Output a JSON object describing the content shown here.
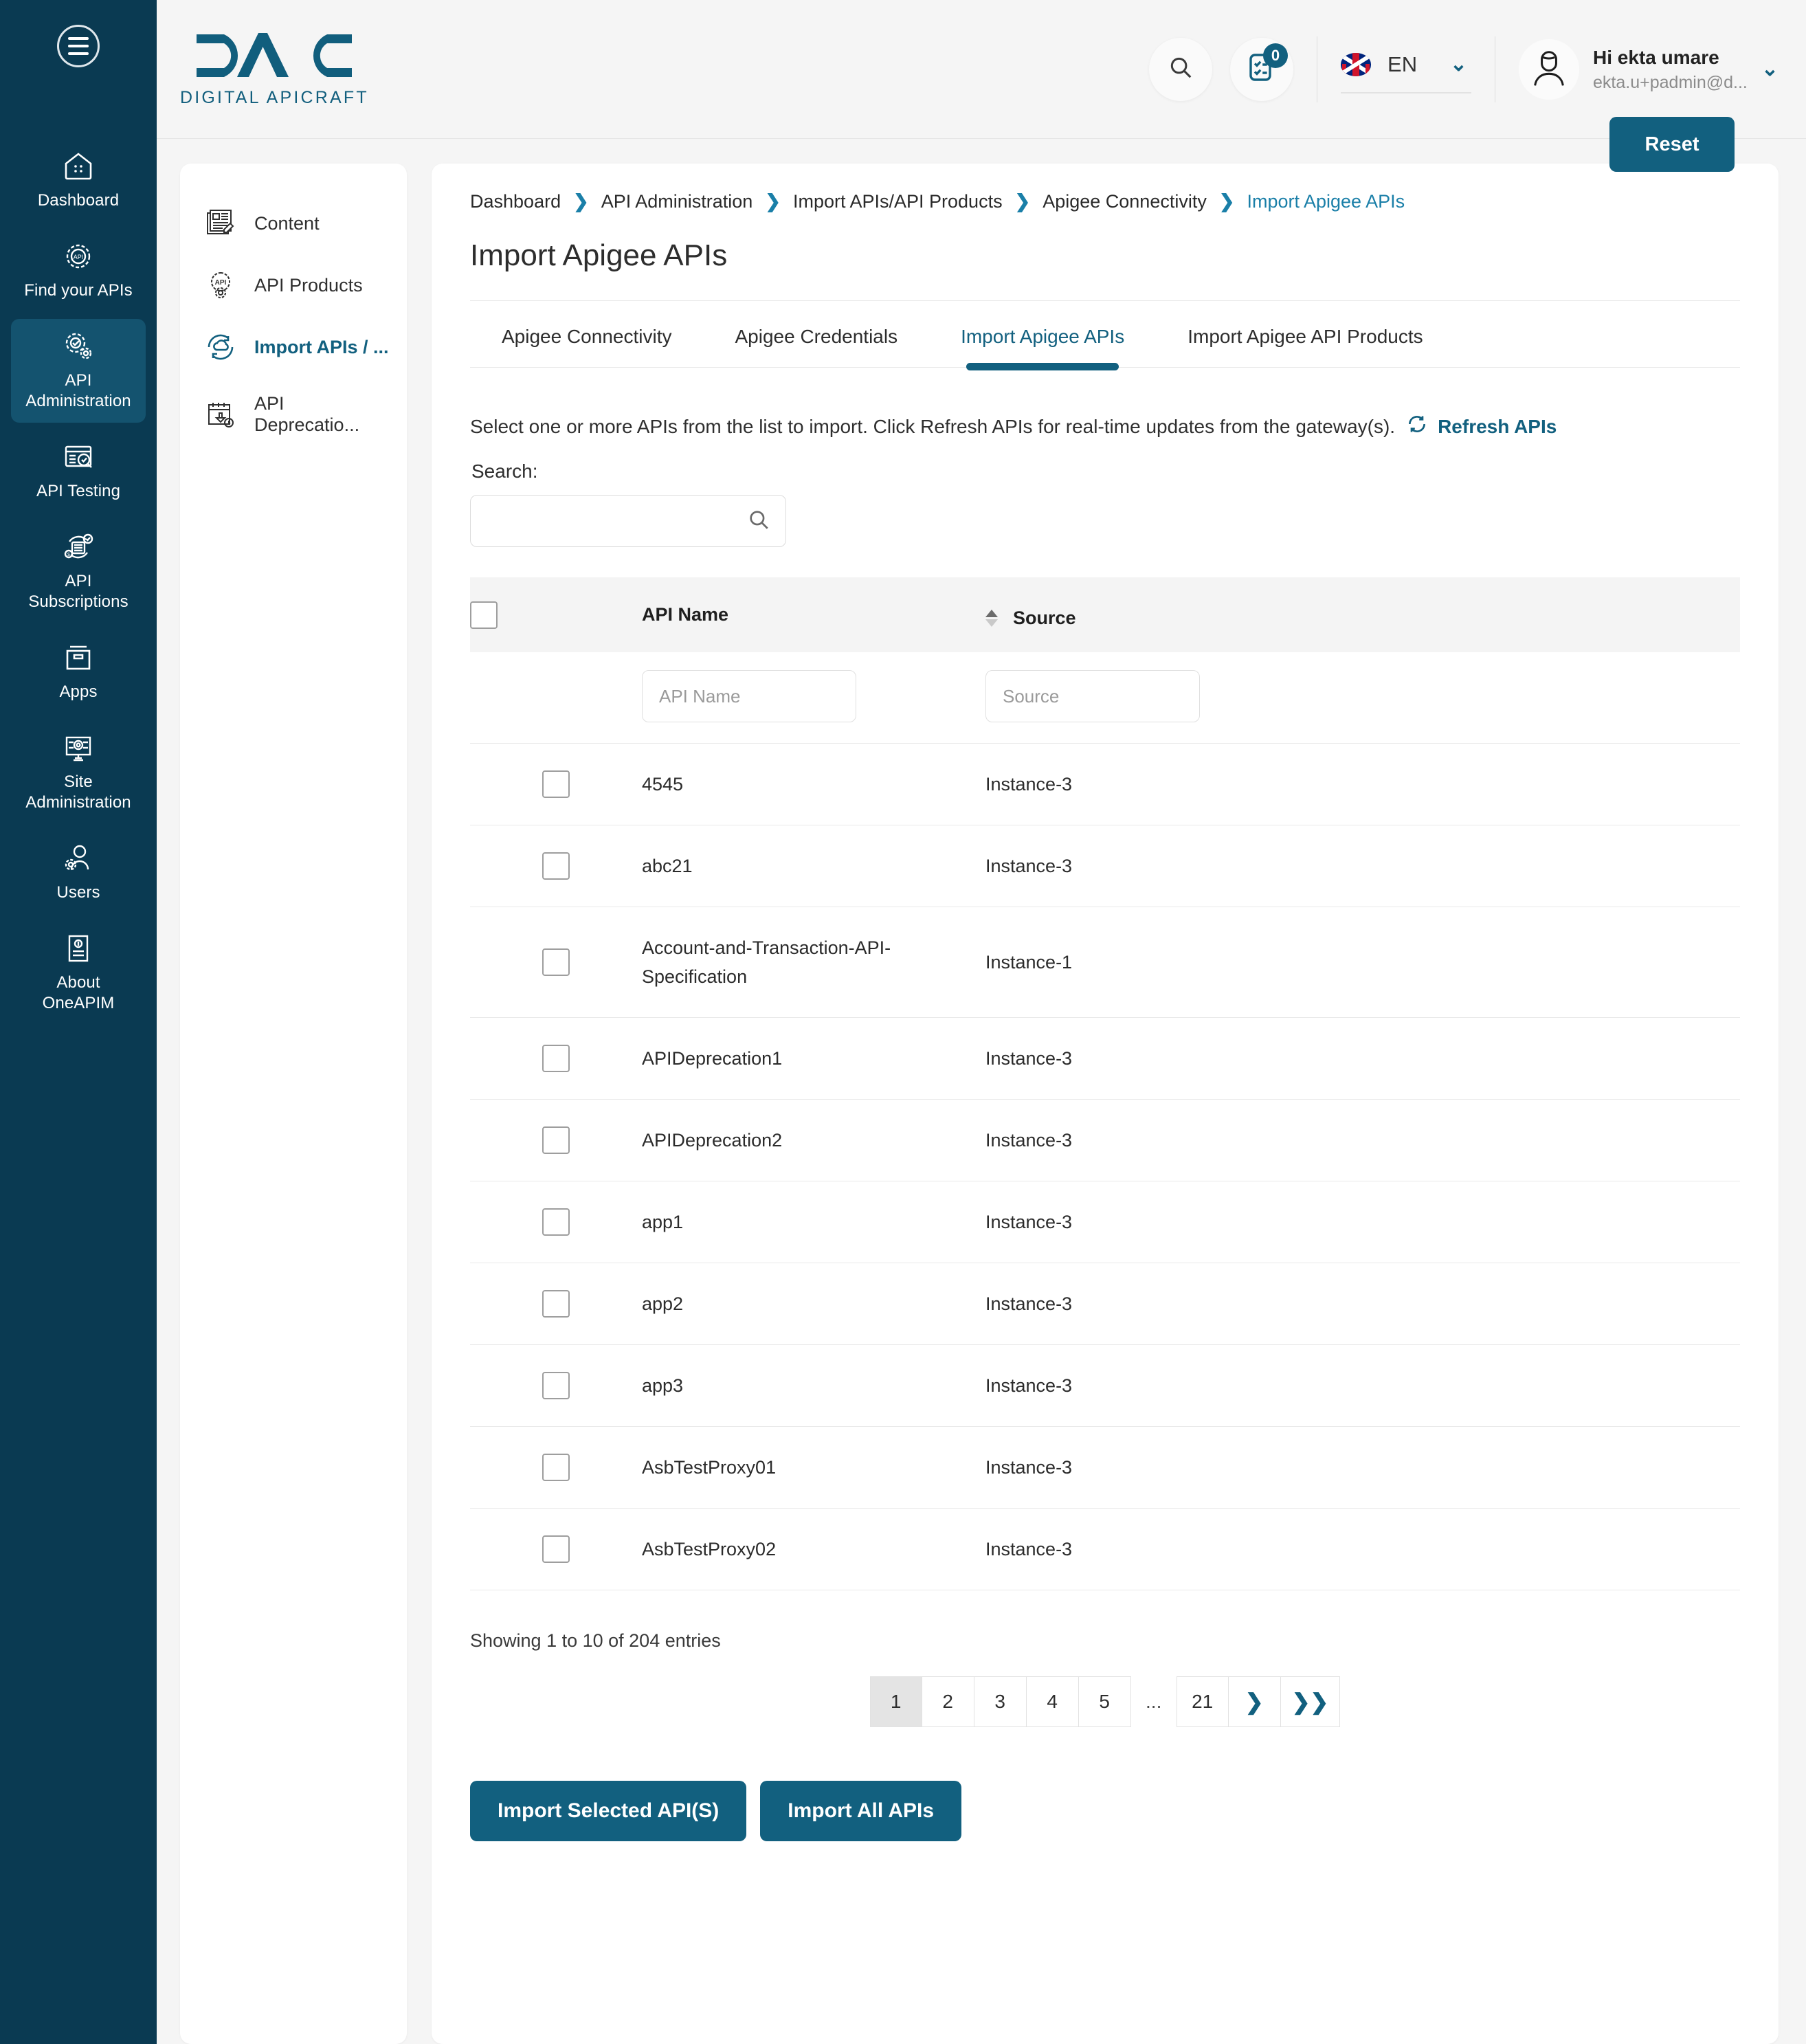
{
  "brand": {
    "logo_text": "DAC",
    "logo_subtitle": "DIGITAL APICRAFT"
  },
  "rail": {
    "toggle_name": "menu-toggle",
    "items": [
      {
        "label": "Dashboard",
        "icon": "home-icon",
        "active": false
      },
      {
        "label": "Find your APIs",
        "icon": "api-gear-icon",
        "active": false
      },
      {
        "label": "API Administration",
        "icon": "api-admin-gear-icon",
        "active": true
      },
      {
        "label": "API Testing",
        "icon": "api-testing-icon",
        "active": false
      },
      {
        "label": "API Subscriptions",
        "icon": "api-subscriptions-icon",
        "active": false
      },
      {
        "label": "Apps",
        "icon": "apps-box-icon",
        "active": false
      },
      {
        "label": "Site Administration",
        "icon": "site-admin-monitor-icon",
        "active": false
      },
      {
        "label": "Users",
        "icon": "users-icon",
        "active": false
      },
      {
        "label": "About OneAPIM",
        "icon": "about-document-icon",
        "active": false
      }
    ]
  },
  "header": {
    "search_icon": "search-icon",
    "notifications_icon": "tasks-icon",
    "notifications_count": "0",
    "language": "EN",
    "language_flag": "uk-flag-icon",
    "language_chevron": "chevron-down-icon",
    "user_greeting": "Hi ekta umare",
    "user_email": "ekta.u+padmin@d...",
    "user_avatar": "avatar-icon",
    "user_chevron": "chevron-down-icon"
  },
  "subnav": {
    "items": [
      {
        "label": "Content",
        "icon": "content-icon",
        "active": false
      },
      {
        "label": "API Products",
        "icon": "api-products-icon",
        "active": false
      },
      {
        "label": "Import APIs / ...",
        "icon": "import-apis-icon",
        "active": true
      },
      {
        "label": "API Deprecatio...",
        "icon": "api-deprecation-icon",
        "active": false
      }
    ]
  },
  "breadcrumb": [
    {
      "label": "Dashboard",
      "current": false
    },
    {
      "label": "API Administration",
      "current": false
    },
    {
      "label": "Import APIs/API Products",
      "current": false
    },
    {
      "label": "Apigee Connectivity",
      "current": false
    },
    {
      "label": "Import Apigee APIs",
      "current": true
    }
  ],
  "page": {
    "title": "Import Apigee APIs"
  },
  "tabs": [
    {
      "label": "Apigee Connectivity",
      "active": false
    },
    {
      "label": "Apigee Credentials",
      "active": false
    },
    {
      "label": "Import Apigee APIs",
      "active": true
    },
    {
      "label": "Import Apigee API Products",
      "active": false
    }
  ],
  "helper": {
    "text": "Select one or more APIs from the list to import. Click Refresh APIs for real-time updates from the gateway(s).",
    "refresh_label": "Refresh APIs",
    "refresh_icon": "refresh-icon"
  },
  "search": {
    "label": "Search:",
    "value": "",
    "placeholder": "",
    "icon": "search-icon"
  },
  "table": {
    "headers": {
      "api_name": "API Name",
      "source": "Source"
    },
    "select_all_checkbox": "select-all-checkbox",
    "sort_icon": "sort-arrows-icon",
    "filters": {
      "api_name_placeholder": "API Name",
      "api_name_value": "",
      "source_placeholder": "Source",
      "source_value": "",
      "reset_label": "Reset"
    },
    "rows": [
      {
        "api_name": "4545",
        "source": "Instance-3",
        "checked": false
      },
      {
        "api_name": "abc21",
        "source": "Instance-3",
        "checked": false
      },
      {
        "api_name": "Account-and-Transaction-API-Specification",
        "source": "Instance-1",
        "checked": false
      },
      {
        "api_name": "APIDeprecation1",
        "source": "Instance-3",
        "checked": false
      },
      {
        "api_name": "APIDeprecation2",
        "source": "Instance-3",
        "checked": false
      },
      {
        "api_name": "app1",
        "source": "Instance-3",
        "checked": false
      },
      {
        "api_name": "app2",
        "source": "Instance-3",
        "checked": false
      },
      {
        "api_name": "app3",
        "source": "Instance-3",
        "checked": false
      },
      {
        "api_name": "AsbTestProxy01",
        "source": "Instance-3",
        "checked": false
      },
      {
        "api_name": "AsbTestProxy02",
        "source": "Instance-3",
        "checked": false
      }
    ]
  },
  "pagination": {
    "entries_text": "Showing 1 to 10 of 204 entries",
    "pages": [
      "1",
      "2",
      "3",
      "4",
      "5",
      "...",
      "21"
    ],
    "active_page": "1",
    "next_icon": "chevron-right-icon",
    "last_icon": "chevron-double-right-icon"
  },
  "footer": {
    "import_selected_label": "Import Selected API(S)",
    "import_all_label": "Import All APIs"
  },
  "colors": {
    "rail_bg": "#0a3a52",
    "rail_active": "#14536f",
    "accent": "#12607f",
    "link": "#1a7fa8",
    "page_bg": "#f5f5f5",
    "table_header_bg": "#f4f4f4"
  }
}
